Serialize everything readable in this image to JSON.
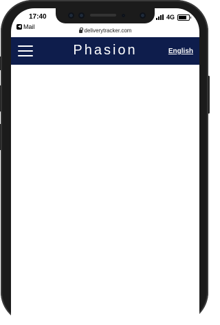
{
  "status_bar": {
    "time": "17:40",
    "back_app": "Mail",
    "network": "4G",
    "battery_level": 0.8
  },
  "browser": {
    "address": "deliverytracker.com"
  },
  "navbar": {
    "brand": "Phasion",
    "language_link": "English",
    "background_color": "#0e1d4c"
  },
  "icons": {
    "menu": "hamburger-icon",
    "lock": "lock-icon",
    "back": "back-arrow-icon",
    "signal": "signal-icon",
    "battery": "battery-icon"
  }
}
